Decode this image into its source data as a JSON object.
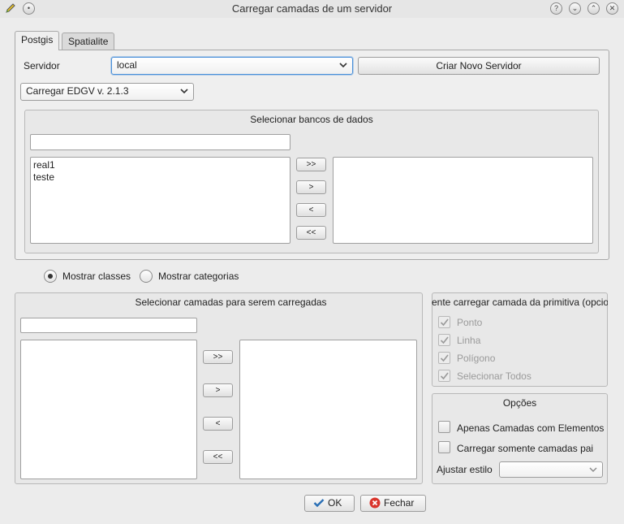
{
  "window": {
    "title": "Carregar camadas de um servidor",
    "controls": [
      "?",
      "⌄",
      "⌃",
      "✕"
    ]
  },
  "tabs": [
    {
      "label": "Postgis",
      "active": true
    },
    {
      "label": "Spatialite",
      "active": false
    }
  ],
  "server": {
    "label": "Servidor",
    "selected": "local",
    "new_button": "Criar Novo Servidor"
  },
  "edgv": {
    "selected": "Carregar EDGV v. 2.1.3"
  },
  "databases": {
    "title": "Selecionar bancos de dados",
    "filter_value": "",
    "available": [
      "real1",
      "teste"
    ],
    "selected": [],
    "buttons": [
      ">>",
      ">",
      "<",
      "<<"
    ]
  },
  "view_mode": {
    "options": [
      {
        "label": "Mostrar classes",
        "checked": true
      },
      {
        "label": "Mostrar categorias",
        "checked": false
      }
    ]
  },
  "layers": {
    "title": "Selecionar camadas para serem carregadas",
    "filter_value": "",
    "available": [],
    "selected": [],
    "buttons": [
      ">>",
      ">",
      "<",
      "<<"
    ]
  },
  "primitive": {
    "title": "ente carregar camada da primitiva (opcio",
    "items": [
      {
        "label": "Ponto",
        "checked": true,
        "enabled": false
      },
      {
        "label": "Linha",
        "checked": true,
        "enabled": false
      },
      {
        "label": "Polígono",
        "checked": true,
        "enabled": false
      },
      {
        "label": "Selecionar Todos",
        "checked": true,
        "enabled": false
      }
    ]
  },
  "options": {
    "title": "Opções",
    "items": [
      {
        "label": "Apenas Camadas com Elementos",
        "checked": false
      },
      {
        "label": "Carregar somente camadas pai",
        "checked": false
      }
    ],
    "style_label": "Ajustar estilo",
    "style_value": ""
  },
  "footer": {
    "ok": "OK",
    "close": "Fechar"
  },
  "colors": {
    "focus": "#4a90d9",
    "close_icon": "#d9342b",
    "ok_check": "#2a6fb5"
  }
}
